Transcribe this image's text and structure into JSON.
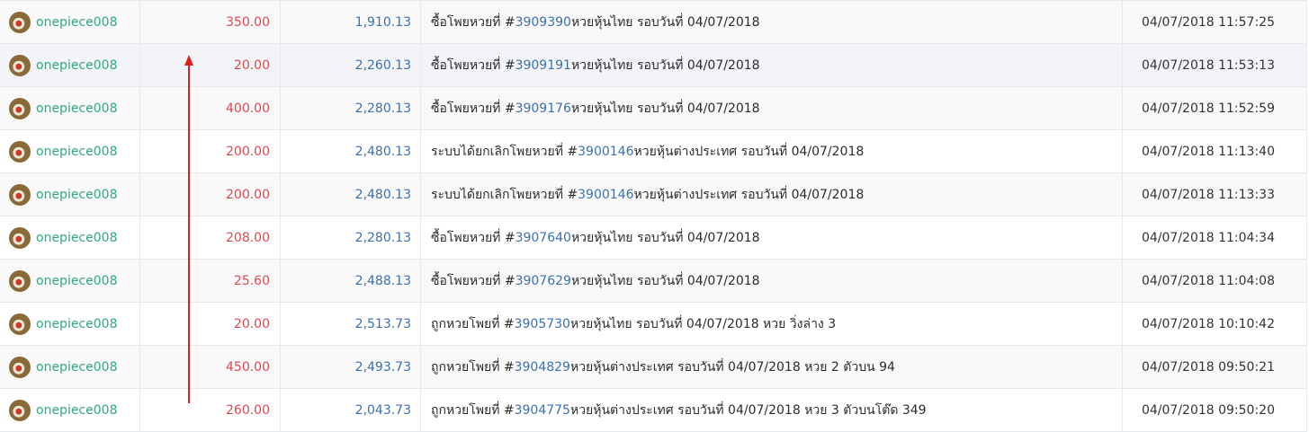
{
  "rows": [
    {
      "user": "onepiece008",
      "amount": "350.00",
      "balance": "1,910.13",
      "desc_prefix": "ซื้อโพยหวยที่ #",
      "ticket": "3909390",
      "desc_suffix": " หวยหุ้นไทย รอบวันที่ 04/07/2018",
      "datetime": "04/07/2018 11:57:25"
    },
    {
      "user": "onepiece008",
      "amount": "20.00",
      "balance": "2,260.13",
      "desc_prefix": "ซื้อโพยหวยที่ #",
      "ticket": "3909191",
      "desc_suffix": " หวยหุ้นไทย รอบวันที่ 04/07/2018",
      "datetime": "04/07/2018 11:53:13"
    },
    {
      "user": "onepiece008",
      "amount": "400.00",
      "balance": "2,280.13",
      "desc_prefix": "ซื้อโพยหวยที่ #",
      "ticket": "3909176",
      "desc_suffix": " หวยหุ้นไทย รอบวันที่ 04/07/2018",
      "datetime": "04/07/2018 11:52:59"
    },
    {
      "user": "onepiece008",
      "amount": "200.00",
      "balance": "2,480.13",
      "desc_prefix": "ระบบได้ยกเลิกโพยหวยที่ #",
      "ticket": "3900146",
      "desc_suffix": " หวยหุ้นต่างประเทศ รอบวันที่ 04/07/2018",
      "datetime": "04/07/2018 11:13:40"
    },
    {
      "user": "onepiece008",
      "amount": "200.00",
      "balance": "2,480.13",
      "desc_prefix": "ระบบได้ยกเลิกโพยหวยที่ #",
      "ticket": "3900146",
      "desc_suffix": " หวยหุ้นต่างประเทศ รอบวันที่ 04/07/2018",
      "datetime": "04/07/2018 11:13:33"
    },
    {
      "user": "onepiece008",
      "amount": "208.00",
      "balance": "2,280.13",
      "desc_prefix": "ซื้อโพยหวยที่ #",
      "ticket": "3907640",
      "desc_suffix": " หวยหุ้นไทย รอบวันที่ 04/07/2018",
      "datetime": "04/07/2018 11:04:34"
    },
    {
      "user": "onepiece008",
      "amount": "25.60",
      "balance": "2,488.13",
      "desc_prefix": "ซื้อโพยหวยที่ #",
      "ticket": "3907629",
      "desc_suffix": " หวยหุ้นไทย รอบวันที่ 04/07/2018",
      "datetime": "04/07/2018 11:04:08"
    },
    {
      "user": "onepiece008",
      "amount": "20.00",
      "balance": "2,513.73",
      "desc_prefix": "ถูกหวยโพยที่ #",
      "ticket": "3905730",
      "desc_suffix": " หวยหุ้นไทย รอบวันที่ 04/07/2018 หวย วิ่งล่าง 3",
      "datetime": "04/07/2018 10:10:42"
    },
    {
      "user": "onepiece008",
      "amount": "450.00",
      "balance": "2,493.73",
      "desc_prefix": "ถูกหวยโพยที่ #",
      "ticket": "3904829",
      "desc_suffix": " หวยหุ้นต่างประเทศ รอบวันที่ 04/07/2018 หวย 2 ตัวบน 94",
      "datetime": "04/07/2018 09:50:21"
    },
    {
      "user": "onepiece008",
      "amount": "260.00",
      "balance": "2,043.73",
      "desc_prefix": "ถูกหวยโพยที่ #",
      "ticket": "3904775",
      "desc_suffix": " หวยหุ้นต่างประเทศ รอบวันที่ 04/07/2018 หวย 3 ตัวบนโต๊ด 349",
      "datetime": "04/07/2018 09:50:20"
    }
  ],
  "colors": {
    "username": "#2faa7c",
    "amount": "#e0484f",
    "balance": "#3d6fb0",
    "link": "#3d6fb0",
    "arrow": "#e02020"
  },
  "icons": {
    "avatar": "user-avatar-icon",
    "annotation": "red-up-arrow"
  }
}
